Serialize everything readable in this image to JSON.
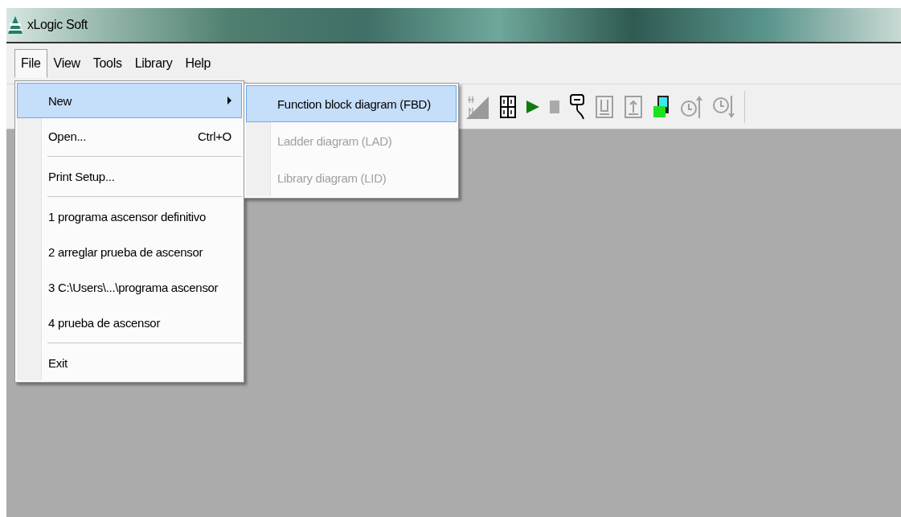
{
  "window": {
    "title": "xLogic Soft"
  },
  "menubar": [
    {
      "label": "File",
      "selected": true
    },
    {
      "label": "View",
      "selected": false
    },
    {
      "label": "Tools",
      "selected": false
    },
    {
      "label": "Library",
      "selected": false
    },
    {
      "label": "Help",
      "selected": false
    }
  ],
  "file_menu": [
    {
      "kind": "item",
      "label": "New",
      "has_submenu": true,
      "selected": true
    },
    {
      "kind": "item",
      "label": "Open...",
      "shortcut": "Ctrl+O",
      "selected": false
    },
    {
      "kind": "separator"
    },
    {
      "kind": "item",
      "label": "Print Setup...",
      "selected": false
    },
    {
      "kind": "separator"
    },
    {
      "kind": "item",
      "label": "1 programa ascensor definitivo",
      "selected": false
    },
    {
      "kind": "item",
      "label": "2 arreglar prueba de ascensor",
      "selected": false
    },
    {
      "kind": "item",
      "label": "3 C:\\Users\\...\\programa ascensor",
      "selected": false
    },
    {
      "kind": "item",
      "label": "4 prueba de ascensor",
      "selected": false
    },
    {
      "kind": "separator"
    },
    {
      "kind": "item",
      "label": "Exit",
      "selected": false
    }
  ],
  "new_submenu": [
    {
      "label": "Function block diagram (FBD)",
      "selected": true,
      "disabled": false
    },
    {
      "label": "Ladder diagram (LAD)",
      "selected": false,
      "disabled": true
    },
    {
      "label": "Library diagram (LID)",
      "selected": false,
      "disabled": true
    }
  ]
}
